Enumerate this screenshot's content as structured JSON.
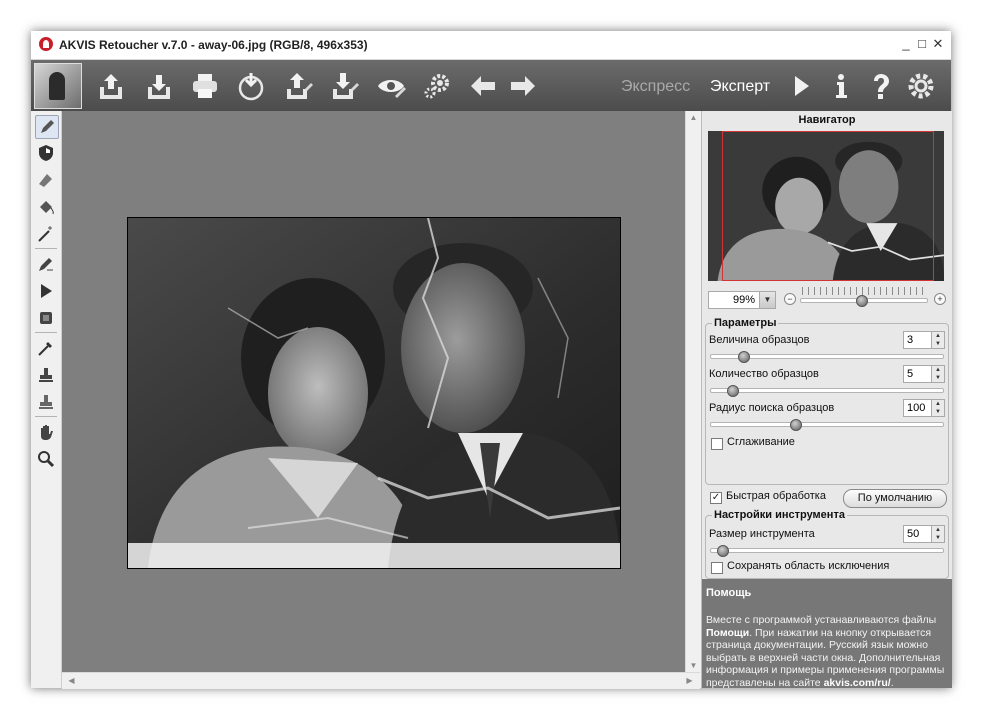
{
  "window": {
    "title": "AKVIS Retoucher v.7.0 - away-06.jpg (RGB/8, 496x353)",
    "controls": [
      "_",
      "□",
      "✕"
    ]
  },
  "toolbar": {
    "buttons": [
      "open-icon",
      "save-icon",
      "print-icon",
      "share-icon",
      "import-icon",
      "export-icon",
      "preview-icon",
      "settings-tools-icon",
      "undo-icon",
      "redo-icon"
    ],
    "modes": [
      "Экспресс",
      "Эксперт"
    ],
    "active_mode": "Эксперт",
    "right_buttons": [
      "run-icon",
      "info-icon",
      "help-icon",
      "preferences-icon"
    ]
  },
  "tools": [
    "retouch-brush",
    "shield",
    "eraser",
    "fill",
    "magic-wand",
    "pencil",
    "run",
    "chip",
    "eyedropper",
    "stamp",
    "stamp-2",
    "hand",
    "zoom"
  ],
  "navigator": {
    "title": "Навигатор",
    "zoom": "99%"
  },
  "params": {
    "title": "Параметры",
    "sample_size_label": "Величина образцов",
    "sample_size": "3",
    "sample_count_label": "Количество образцов",
    "sample_count": "5",
    "search_radius_label": "Радиус поиска образцов",
    "search_radius": "100",
    "smoothing_label": "Сглаживание",
    "smoothing_checked": false
  },
  "fast_processing": {
    "label": "Быстрая обработка",
    "checked": true,
    "default_button": "По умолчанию"
  },
  "tool_settings": {
    "title": "Настройки инструмента",
    "brush_size_label": "Размер инструмента",
    "brush_size": "50",
    "keep_exclusion_label": "Сохранять область исключения",
    "keep_exclusion_checked": false
  },
  "help": {
    "title": "Помощь",
    "p1": "Вместе с программой устанавливаются файлы ",
    "p1_bold": "Помощи",
    "p2": ". При нажатии на кнопку открывается страница документации. Русский язык можно выбрать в верхней части окна. Дополнительная информация и примеры применения программы представлены на сайте ",
    "link": "akvis.com/ru/",
    "p3": "."
  },
  "colors": {
    "toolbar_bg": "#555555",
    "canvas_bg": "#7f7f7f",
    "help_bg": "#777777",
    "accent_red": "#c8202a"
  }
}
